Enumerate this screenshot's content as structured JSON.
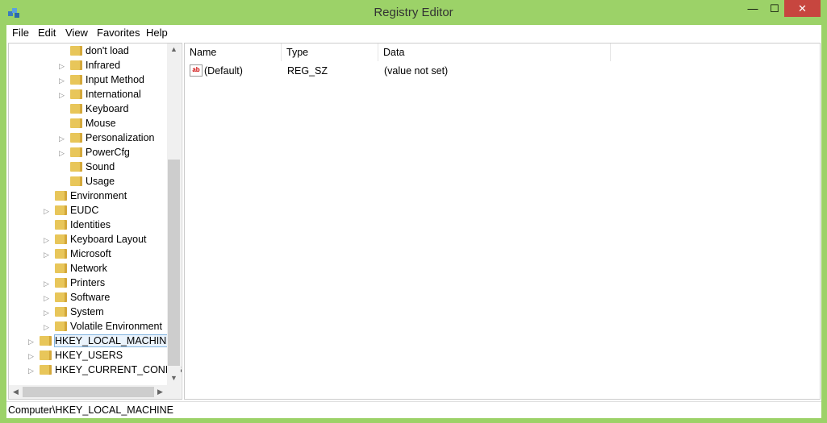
{
  "window": {
    "title": "Registry Editor",
    "minimize_glyph": "—",
    "maximize_glyph": "☐",
    "close_glyph": "✕",
    "accent": "#9cd268"
  },
  "menu": {
    "file": "File",
    "edit": "Edit",
    "view": "View",
    "favorites": "Favorites",
    "help": "Help"
  },
  "tree": {
    "items": [
      {
        "label": "don't load",
        "level": 3,
        "expandable": false
      },
      {
        "label": "Infrared",
        "level": 3,
        "expandable": true
      },
      {
        "label": "Input Method",
        "level": 3,
        "expandable": true
      },
      {
        "label": "International",
        "level": 3,
        "expandable": true
      },
      {
        "label": "Keyboard",
        "level": 3,
        "expandable": false
      },
      {
        "label": "Mouse",
        "level": 3,
        "expandable": false
      },
      {
        "label": "Personalization",
        "level": 3,
        "expandable": true
      },
      {
        "label": "PowerCfg",
        "level": 3,
        "expandable": true
      },
      {
        "label": "Sound",
        "level": 3,
        "expandable": false
      },
      {
        "label": "Usage",
        "level": 3,
        "expandable": false
      },
      {
        "label": "Environment",
        "level": 2,
        "expandable": false
      },
      {
        "label": "EUDC",
        "level": 2,
        "expandable": true
      },
      {
        "label": "Identities",
        "level": 2,
        "expandable": false
      },
      {
        "label": "Keyboard Layout",
        "level": 2,
        "expandable": true
      },
      {
        "label": "Microsoft",
        "level": 2,
        "expandable": true
      },
      {
        "label": "Network",
        "level": 2,
        "expandable": false
      },
      {
        "label": "Printers",
        "level": 2,
        "expandable": true
      },
      {
        "label": "Software",
        "level": 2,
        "expandable": true
      },
      {
        "label": "System",
        "level": 2,
        "expandable": true
      },
      {
        "label": "Volatile Environment",
        "level": 2,
        "expandable": true
      },
      {
        "label": "HKEY_LOCAL_MACHINE",
        "level": 1,
        "expandable": true,
        "selected": true
      },
      {
        "label": "HKEY_USERS",
        "level": 1,
        "expandable": true
      },
      {
        "label": "HKEY_CURRENT_CONFIG",
        "level": 1,
        "expandable": true
      }
    ]
  },
  "list": {
    "columns": [
      "Name",
      "Type",
      "Data"
    ],
    "rows": [
      {
        "name": "(Default)",
        "type": "REG_SZ",
        "data": "(value not set)",
        "icon": "string-value-icon",
        "icon_text": "ab"
      }
    ]
  },
  "status": {
    "path": "Computer\\HKEY_LOCAL_MACHINE"
  }
}
